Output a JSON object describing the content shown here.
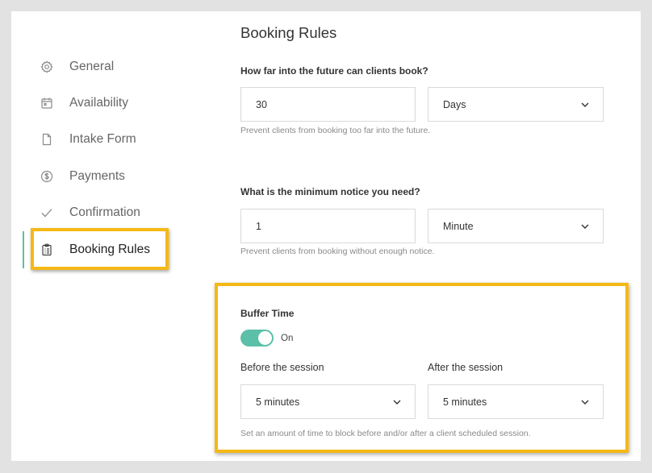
{
  "sidebar": {
    "items": [
      {
        "label": "General",
        "icon": "gear-icon"
      },
      {
        "label": "Availability",
        "icon": "calendar-icon"
      },
      {
        "label": "Intake Form",
        "icon": "document-icon"
      },
      {
        "label": "Payments",
        "icon": "dollar-circle-icon"
      },
      {
        "label": "Confirmation",
        "icon": "checkmark-icon"
      },
      {
        "label": "Booking Rules",
        "icon": "clipboard-icon",
        "active": true
      }
    ]
  },
  "main": {
    "title": "Booking Rules",
    "future_booking": {
      "question": "How far into the future can clients book?",
      "value": "30",
      "unit": "Days",
      "help": "Prevent clients from booking too far into the future."
    },
    "minimum_notice": {
      "question": "What is the minimum notice you need?",
      "value": "1",
      "unit": "Minute",
      "help": "Prevent clients from booking without enough notice."
    },
    "buffer_time": {
      "label": "Buffer Time",
      "toggle_on": true,
      "toggle_label": "On",
      "before_label": "Before the session",
      "before_value": "5 minutes",
      "after_label": "After the session",
      "after_value": "5 minutes",
      "help": "Set an amount of time to block before and/or after a client scheduled session."
    }
  },
  "colors": {
    "accent": "#5cbfa7",
    "highlight": "#f5b816"
  }
}
